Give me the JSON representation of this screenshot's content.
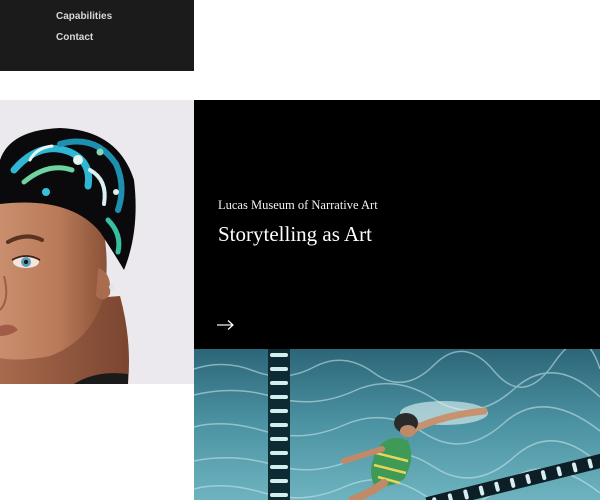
{
  "nav": {
    "items": [
      {
        "label": "Capabilities"
      },
      {
        "label": "Contact"
      }
    ]
  },
  "feature": {
    "kicker": "Lucas Museum of Narrative Art",
    "title": "Storytelling as Art",
    "arrow_icon": "arrow-right-icon"
  },
  "images": {
    "portrait": "swimmer-portrait-image",
    "pool": "pool-swimmer-image"
  },
  "colors": {
    "nav_bg": "#1b1b1b",
    "card_bg": "#000000",
    "text_light": "#ffffff"
  }
}
